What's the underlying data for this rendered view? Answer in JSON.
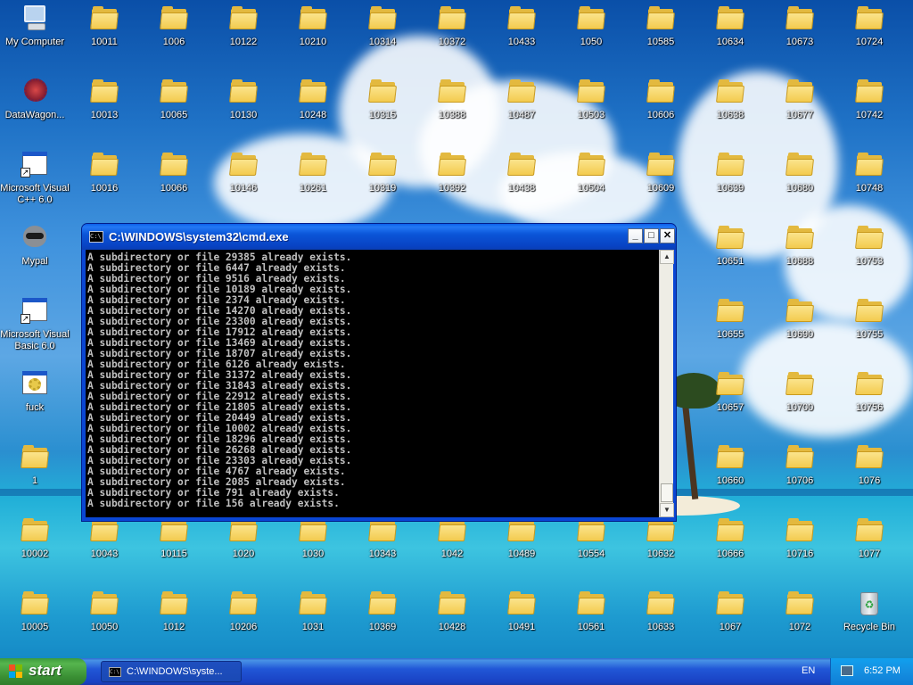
{
  "desktop": {
    "special_icons": [
      {
        "name": "my-computer",
        "label": "My Computer"
      },
      {
        "name": "datawagon",
        "label": "DataWagon..."
      },
      {
        "name": "visual-cpp",
        "label": "Microsoft Visual C++ 6.0"
      },
      {
        "name": "mypal",
        "label": "Mypal"
      },
      {
        "name": "visual-basic",
        "label": "Microsoft Visual Basic 6.0"
      },
      {
        "name": "fuck",
        "label": "fuck"
      },
      {
        "name": "recycle-bin",
        "label": "Recycle Bin"
      }
    ],
    "folders": [
      "10011",
      "1006",
      "10122",
      "10210",
      "10314",
      "10372",
      "10433",
      "1050",
      "10585",
      "10634",
      "10673",
      "10724",
      "10013",
      "10065",
      "10130",
      "10248",
      "10315",
      "10388",
      "10487",
      "10503",
      "10606",
      "10638",
      "10677",
      "10742",
      "10016",
      "10066",
      "10146",
      "10261",
      "10319",
      "10392",
      "10438",
      "10504",
      "10609",
      "10639",
      "10680",
      "10748",
      "10651",
      "10688",
      "10753",
      "10655",
      "10690",
      "10755",
      "10657",
      "10700",
      "10756",
      "1",
      "10660",
      "10706",
      "1076",
      "10002",
      "10043",
      "10115",
      "1020",
      "1030",
      "10343",
      "1042",
      "10489",
      "10554",
      "10632",
      "10666",
      "10716",
      "1077",
      "10005",
      "10050",
      "1012",
      "10206",
      "1031",
      "10369",
      "10428",
      "10491",
      "10561",
      "10633",
      "1067",
      "1072"
    ]
  },
  "cmd_window": {
    "title": "C:\\WINDOWS\\system32\\cmd.exe",
    "icon_text": "C:\\",
    "min_symbol": "_",
    "max_symbol": "□",
    "close_symbol": "✕",
    "lines": [
      "A subdirectory or file 29385 already exists.",
      "A subdirectory or file 6447 already exists.",
      "A subdirectory or file 9516 already exists.",
      "A subdirectory or file 10189 already exists.",
      "A subdirectory or file 2374 already exists.",
      "A subdirectory or file 14270 already exists.",
      "A subdirectory or file 23300 already exists.",
      "A subdirectory or file 17912 already exists.",
      "A subdirectory or file 13469 already exists.",
      "A subdirectory or file 18707 already exists.",
      "A subdirectory or file 6126 already exists.",
      "A subdirectory or file 31372 already exists.",
      "A subdirectory or file 31843 already exists.",
      "A subdirectory or file 22912 already exists.",
      "A subdirectory or file 21805 already exists.",
      "A subdirectory or file 20449 already exists.",
      "A subdirectory or file 10002 already exists.",
      "A subdirectory or file 18296 already exists.",
      "A subdirectory or file 26268 already exists.",
      "A subdirectory or file 23303 already exists.",
      "A subdirectory or file 4767 already exists.",
      "A subdirectory or file 2085 already exists.",
      "A subdirectory or file 791 already exists.",
      "A subdirectory or file 156 already exists."
    ],
    "scroll_up_symbol": "▲",
    "scroll_down_symbol": "▼"
  },
  "taskbar": {
    "start_label": "start",
    "tasks": [
      {
        "label": "C:\\WINDOWS\\syste...",
        "icon_text": "C:\\"
      }
    ],
    "language": "EN",
    "clock": "6:52 PM",
    "colors": {
      "taskbar": "#2157d7",
      "start": "#3a8f34",
      "tray": "#1592e3"
    }
  }
}
